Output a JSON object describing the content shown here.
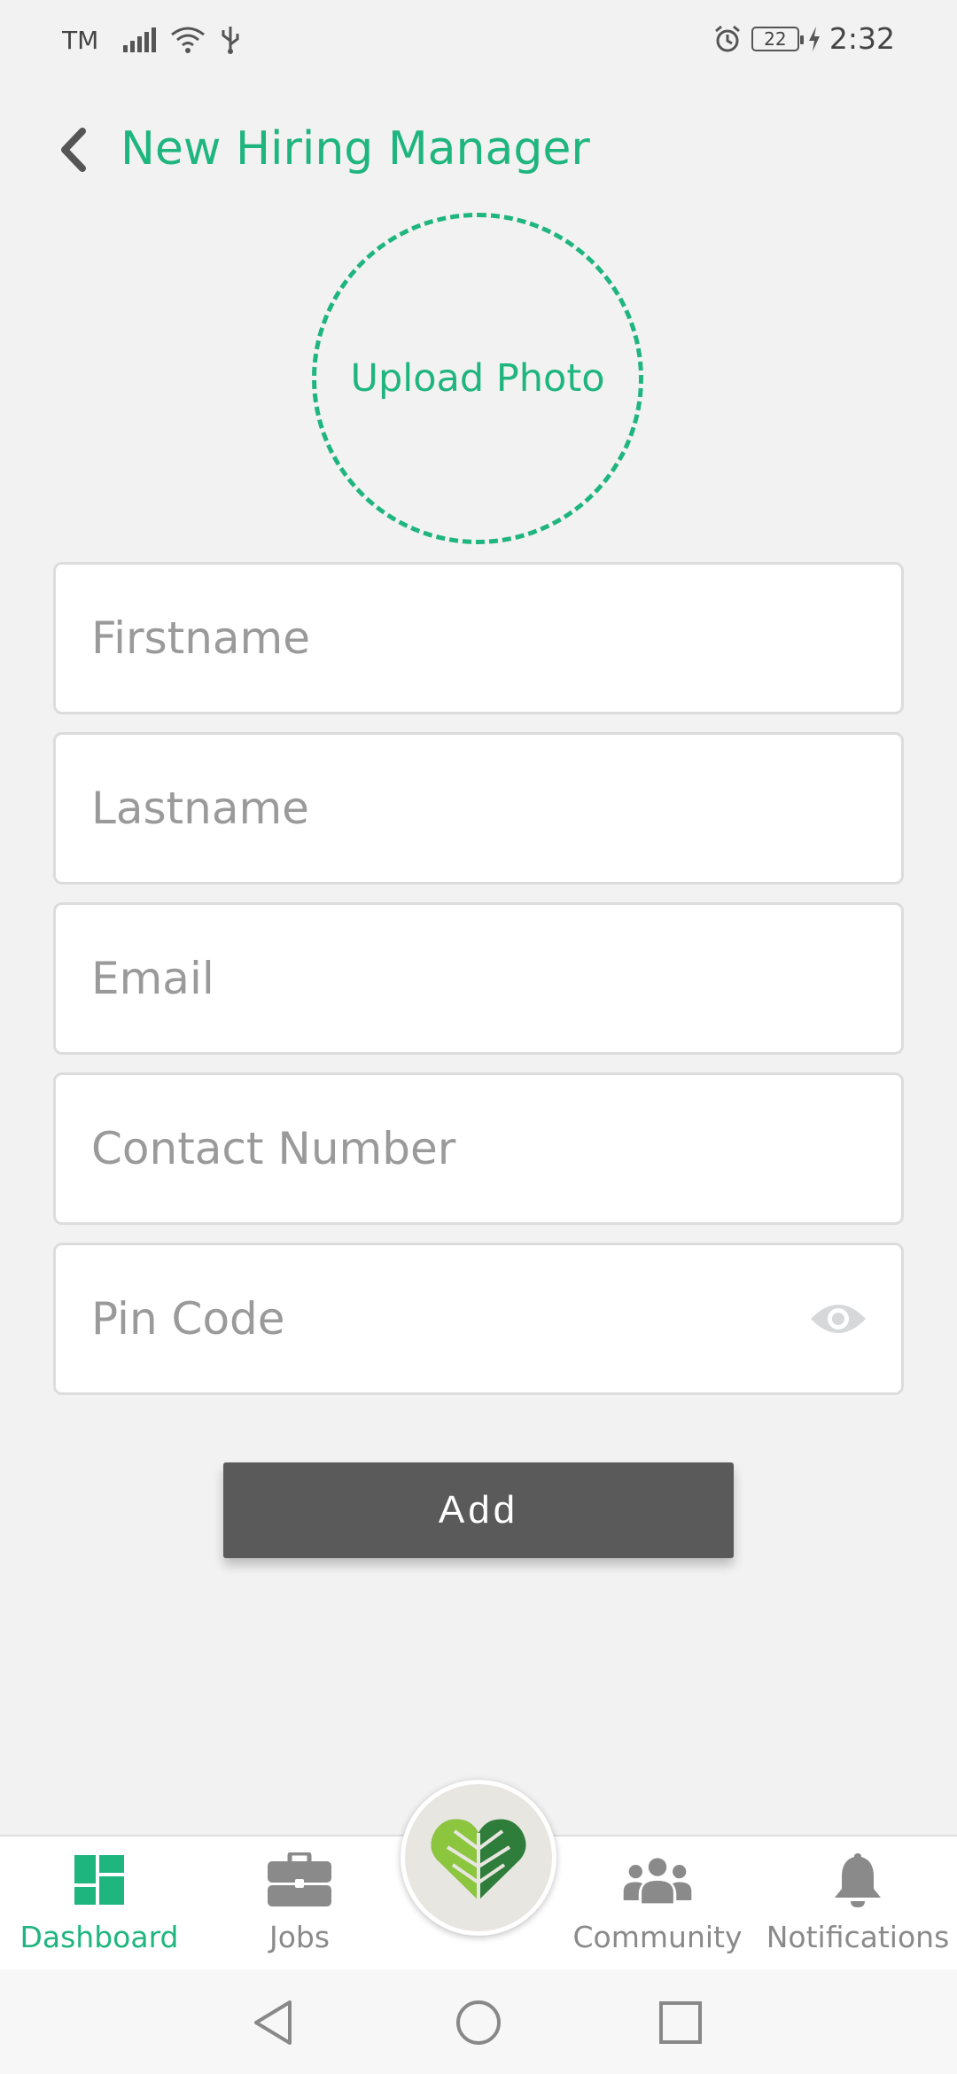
{
  "status_bar": {
    "carrier": "TM",
    "battery": "22",
    "time": "2:32"
  },
  "header": {
    "title": "New Hiring Manager",
    "back_icon": "chevron-left-icon"
  },
  "upload": {
    "label": "Upload Photo"
  },
  "form": {
    "firstname_placeholder": "Firstname",
    "lastname_placeholder": "Lastname",
    "email_placeholder": "Email",
    "contact_placeholder": "Contact Number",
    "pin_placeholder": "Pin Code",
    "add_label": "Add"
  },
  "bottom_nav": {
    "items": [
      {
        "label": "Dashboard",
        "icon": "dashboard-icon",
        "active": true
      },
      {
        "label": "Jobs",
        "icon": "briefcase-icon",
        "active": false
      },
      {
        "label": "Community",
        "icon": "people-icon",
        "active": false
      },
      {
        "label": "Notifications",
        "icon": "bell-icon",
        "active": false
      }
    ]
  },
  "colors": {
    "accent": "#1fb57f",
    "button": "#5a5a5a",
    "background": "#f2f2f2"
  }
}
